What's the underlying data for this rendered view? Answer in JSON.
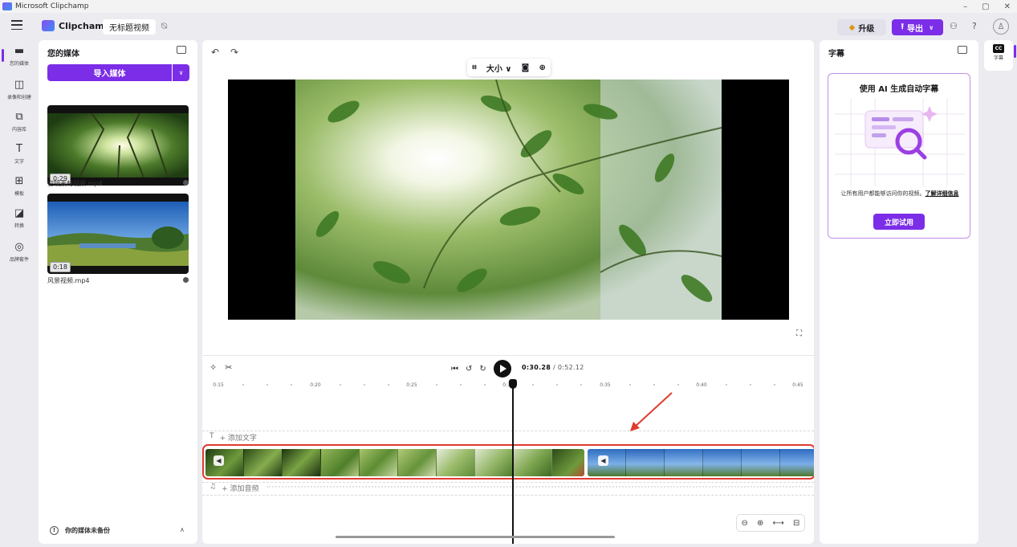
{
  "window": {
    "title": "Microsoft Clipchamp",
    "controls": [
      "–",
      "▢",
      "✕"
    ]
  },
  "header": {
    "brand": "Clipchamp",
    "project_name": "无标题视频",
    "upgrade_label": "升级",
    "export_label": "导出"
  },
  "left_rail": {
    "items": [
      {
        "label": "您的媒体",
        "icon": "folder-icon",
        "glyph": "▬"
      },
      {
        "label": "录像和创建",
        "icon": "camera-icon",
        "glyph": "◫"
      },
      {
        "label": "内容库",
        "icon": "library-icon",
        "glyph": "⧉"
      },
      {
        "label": "文字",
        "icon": "text-icon",
        "glyph": "T"
      },
      {
        "label": "模板",
        "icon": "templates-icon",
        "glyph": "⊞"
      },
      {
        "label": "转换",
        "icon": "transitions-icon",
        "glyph": "◪"
      },
      {
        "label": "品牌套件",
        "icon": "brand-kit-icon",
        "glyph": "◎"
      }
    ]
  },
  "media": {
    "title": "您的媒体",
    "import_label": "导入媒体",
    "items": [
      {
        "duration": "0:29",
        "filename": "空镜素材视频.mp4"
      },
      {
        "duration": "0:18",
        "filename": "风景视频.mp4"
      }
    ],
    "backup_text": "你的媒体未备份"
  },
  "preview": {
    "toolbar_size_label": "大小"
  },
  "timeline": {
    "current_time": "0:30.28",
    "total_time": "/ 0:52.12",
    "ruler": [
      "0:15",
      "0:20",
      "0:25",
      "0:30",
      "0:35",
      "0:40",
      "0:45"
    ],
    "add_text_label": "+ 添加文字",
    "add_audio_label": "+ 添加音频"
  },
  "captions": {
    "panel_title": "字幕",
    "card_title": "使用 AI 生成自动字幕",
    "card_desc": "让所有用户都能够访问你的视频。",
    "learn_more": "了解详细信息",
    "try_label": "立即试用",
    "rail_label": "字幕",
    "cc_text": "CC"
  },
  "colors": {
    "accent": "#7b2de8",
    "highlight_red": "#e03b2f"
  }
}
